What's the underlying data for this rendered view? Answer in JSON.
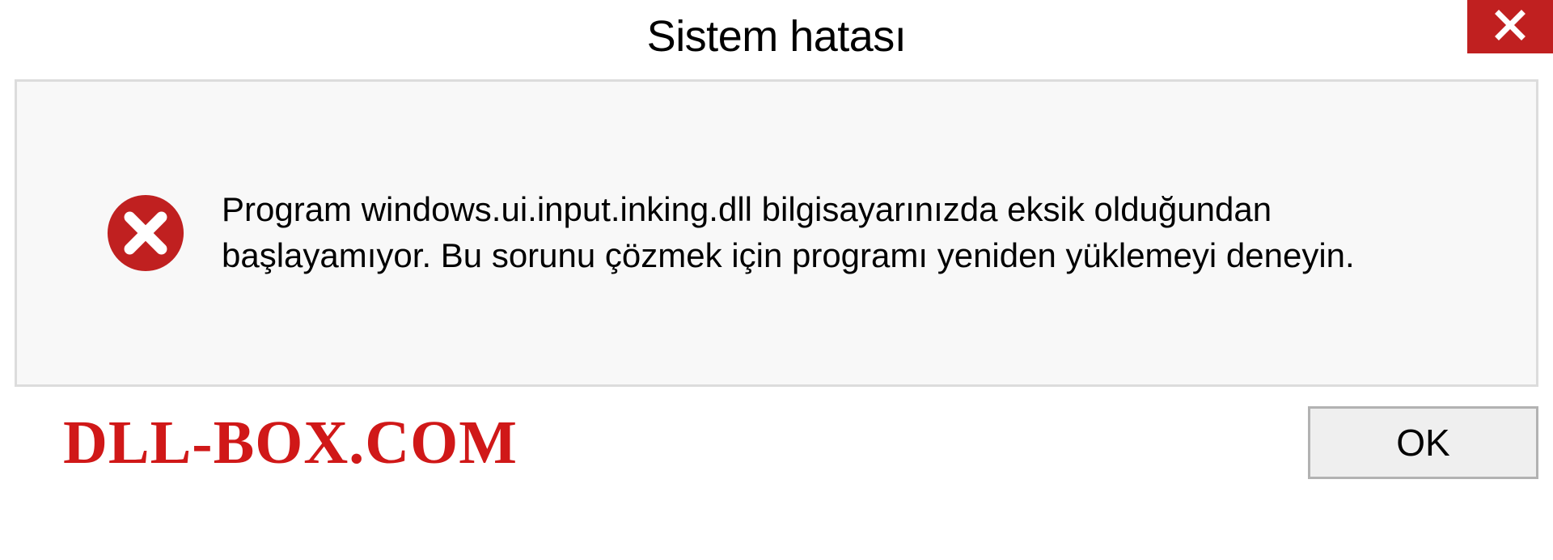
{
  "titlebar": {
    "title": "Sistem hatası"
  },
  "dialog": {
    "message": "Program windows.ui.input.inking.dll bilgisayarınızda eksik olduğundan başlayamıyor. Bu sorunu çözmek için programı yeniden yüklemeyi deneyin."
  },
  "footer": {
    "watermark": "DLL-BOX.COM",
    "ok_label": "OK"
  },
  "colors": {
    "close_bg": "#c02020",
    "error_icon": "#c02020",
    "watermark": "#d01818",
    "border": "#dcdcdc",
    "content_bg": "#f8f8f8",
    "button_bg": "#efefef",
    "button_border": "#b2b2b2"
  },
  "icons": {
    "close": "close-x",
    "error": "error-circle-x"
  }
}
